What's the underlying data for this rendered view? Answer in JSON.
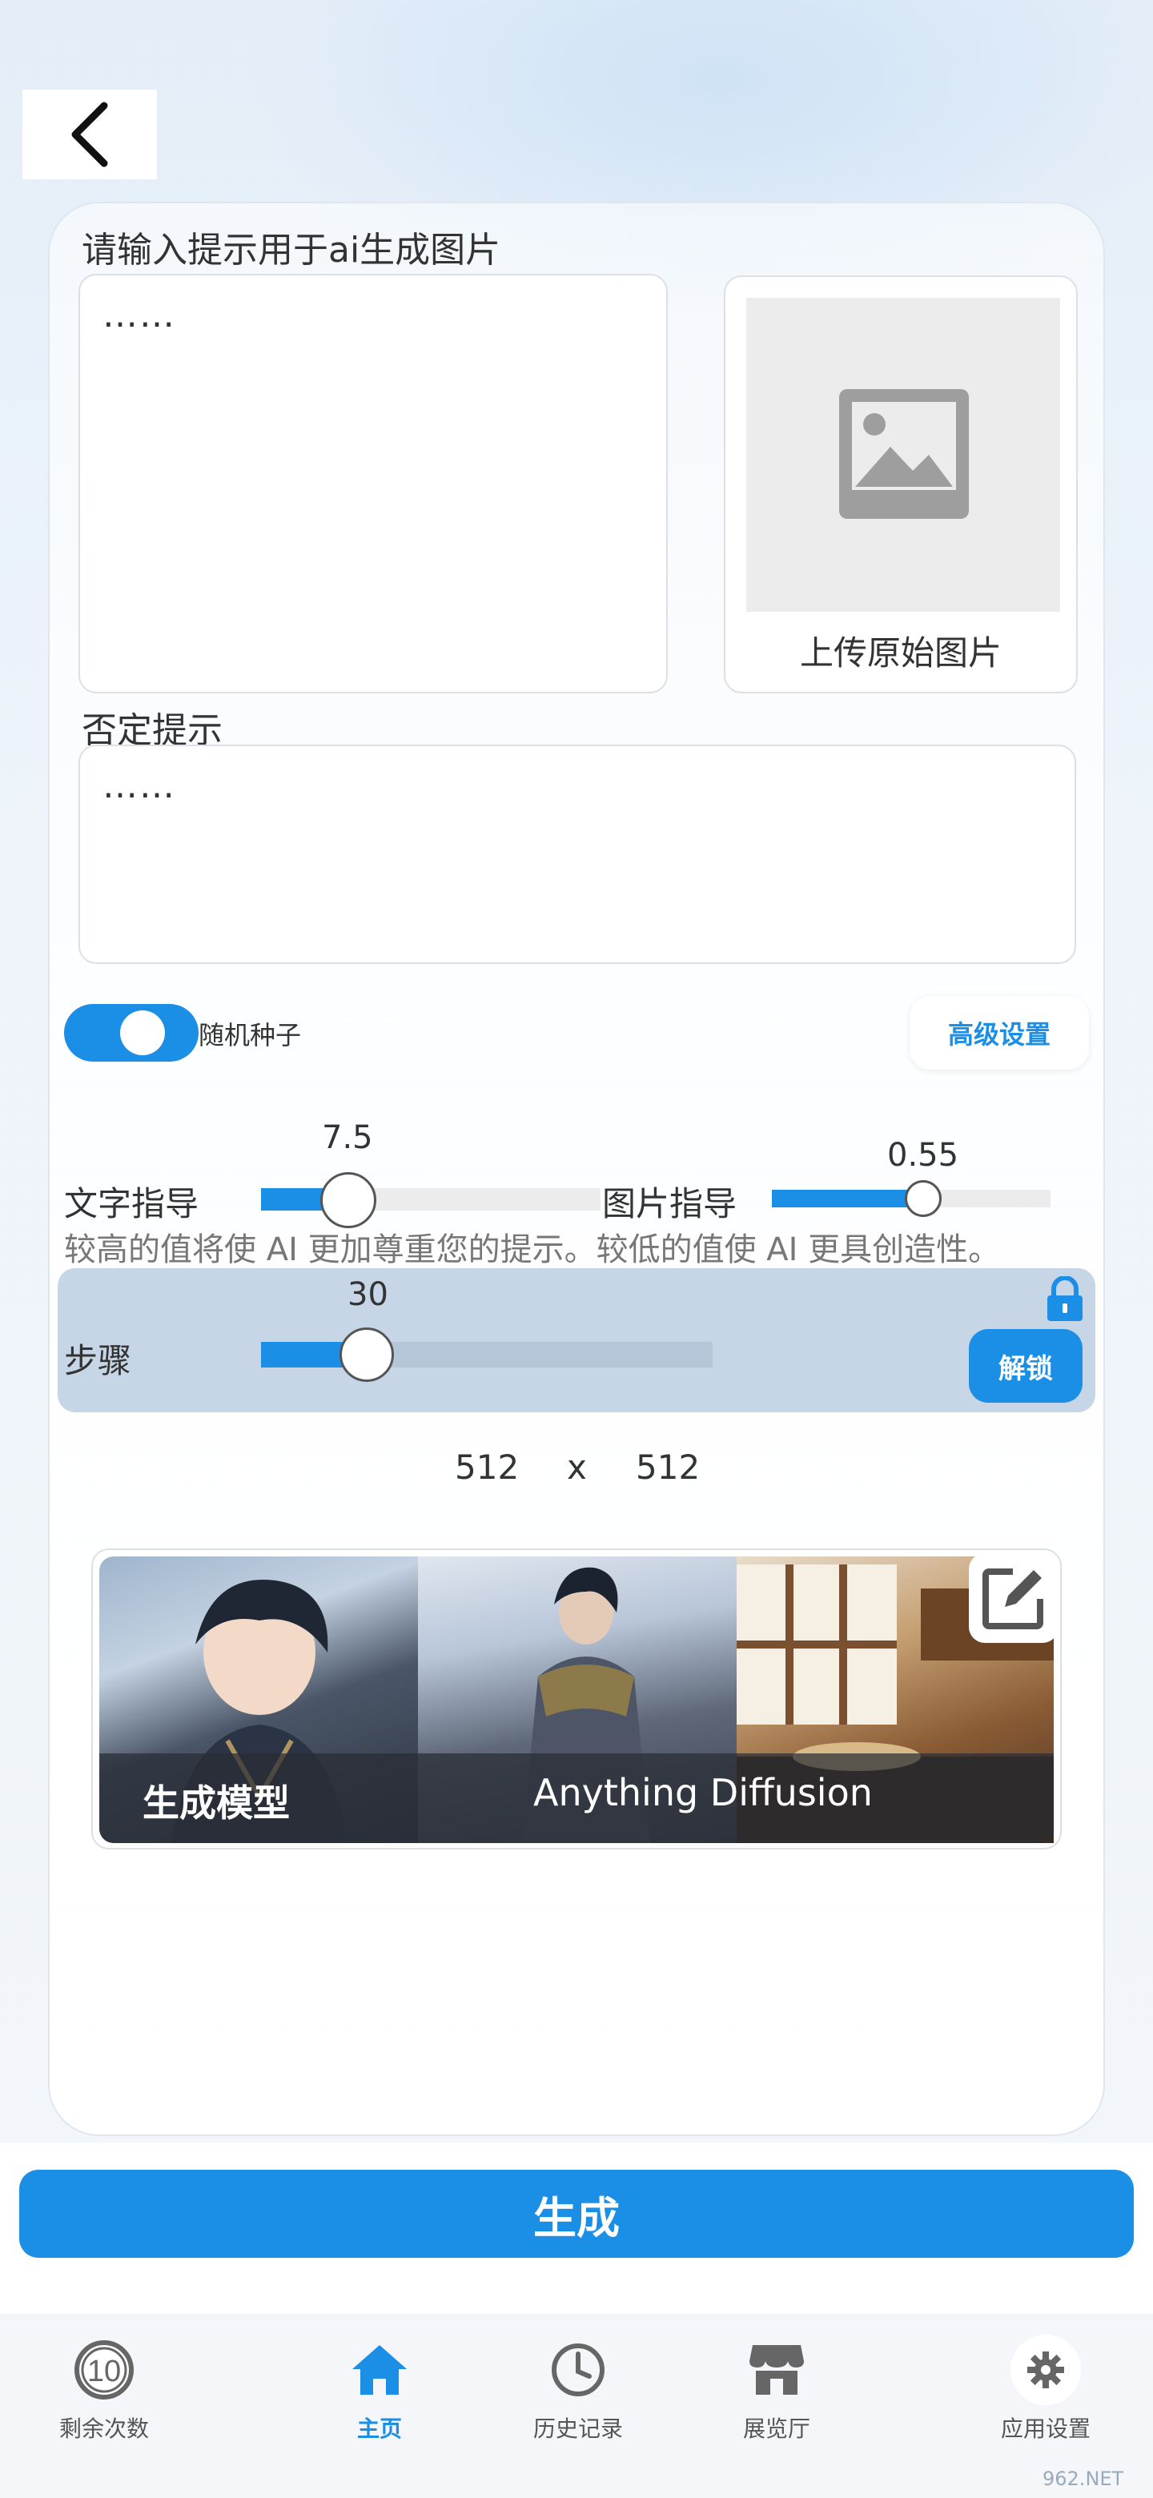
{
  "colors": {
    "accent": "#1b8ee6",
    "panel": "#c6d6e6",
    "text": "#333333",
    "hint": "#777777"
  },
  "back_icon": "chevron-left-icon",
  "prompt": {
    "label": "请输入提示用于ai生成图片",
    "value": "……"
  },
  "upload": {
    "label": "上传原始图片",
    "icon": "image-icon"
  },
  "negative": {
    "label": "否定提示",
    "value": "……"
  },
  "seed": {
    "label": "随机种子",
    "enabled": true
  },
  "advanced_button": "高级设置",
  "text_guidance": {
    "label": "文字指导",
    "value": "7.5"
  },
  "image_guidance": {
    "label": "图片指导",
    "value": "0.55"
  },
  "hint": "较高的值将使 AI 更加尊重您的提示。较低的值使 AI 更具创造性。",
  "steps": {
    "label": "步骤",
    "value": "30",
    "locked": true,
    "unlock_button": "解锁"
  },
  "size": {
    "width": "512",
    "sep": "x",
    "height": "512"
  },
  "model": {
    "title": "生成模型",
    "name": "Anything Diffusion",
    "edit_icon": "edit-icon"
  },
  "generate_button": "生成",
  "nav": {
    "items": [
      {
        "label": "剩余次数",
        "icon": "counter-icon",
        "badge": "10",
        "active": false
      },
      {
        "label": "主页",
        "icon": "home-icon",
        "active": true
      },
      {
        "label": "历史记录",
        "icon": "clock-icon",
        "active": false
      },
      {
        "label": "展览厅",
        "icon": "store-icon",
        "active": false
      },
      {
        "label": "应用设置",
        "icon": "gear-icon",
        "active": false
      }
    ]
  },
  "watermark": "962.NET"
}
